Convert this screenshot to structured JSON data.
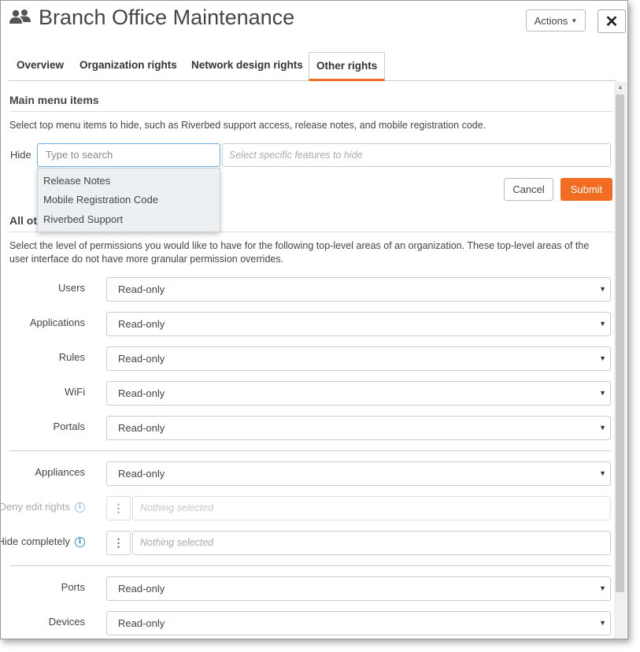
{
  "window": {
    "title": "Branch Office Maintenance",
    "actions_label": "Actions",
    "close_label": "✕"
  },
  "tabs": [
    {
      "label": "Overview",
      "active": false
    },
    {
      "label": "Organization rights",
      "active": false
    },
    {
      "label": "Network design rights",
      "active": false
    },
    {
      "label": "Other rights",
      "active": true
    }
  ],
  "main_menu": {
    "title": "Main menu items",
    "description": "Select top menu items to hide, such as Riverbed support access, release notes, and mobile registration code.",
    "hide_label": "Hide",
    "search_placeholder": "Type to search",
    "features_placeholder": "Select specific features to hide",
    "dropdown_items": [
      "Release Notes",
      "Mobile Registration Code",
      "Riverbed Support"
    ],
    "cancel_label": "Cancel",
    "submit_label": "Submit"
  },
  "all_other": {
    "title_visible": "All ot",
    "description": "Select the level of permissions you would like to have for the following top-level areas of an organization. These top-level areas of the user interface do not have more granular permission overrides."
  },
  "permissions": {
    "users": {
      "label": "Users",
      "value": "Read-only"
    },
    "applications": {
      "label": "Applications",
      "value": "Read-only"
    },
    "rules": {
      "label": "Rules",
      "value": "Read-only"
    },
    "wifi": {
      "label": "WiFi",
      "value": "Read-only"
    },
    "portals": {
      "label": "Portals",
      "value": "Read-only"
    },
    "appliances": {
      "label": "Appliances",
      "value": "Read-only"
    },
    "deny_edit": {
      "label": "Deny edit rights",
      "value": "Nothing selected"
    },
    "hide_completely": {
      "label": "Hide completely",
      "value": "Nothing selected"
    },
    "ports": {
      "label": "Ports",
      "value": "Read-only"
    },
    "devices": {
      "label": "Devices",
      "value": "Read-only"
    }
  },
  "colors": {
    "accent": "#f26d21",
    "info": "#3a87c8",
    "focus_border": "#66afe9"
  },
  "icons": {
    "title": "users-group-icon",
    "info": "info-icon",
    "kebab": "vertical-ellipsis-icon",
    "dropdown_arrow": "caret-down-icon"
  }
}
